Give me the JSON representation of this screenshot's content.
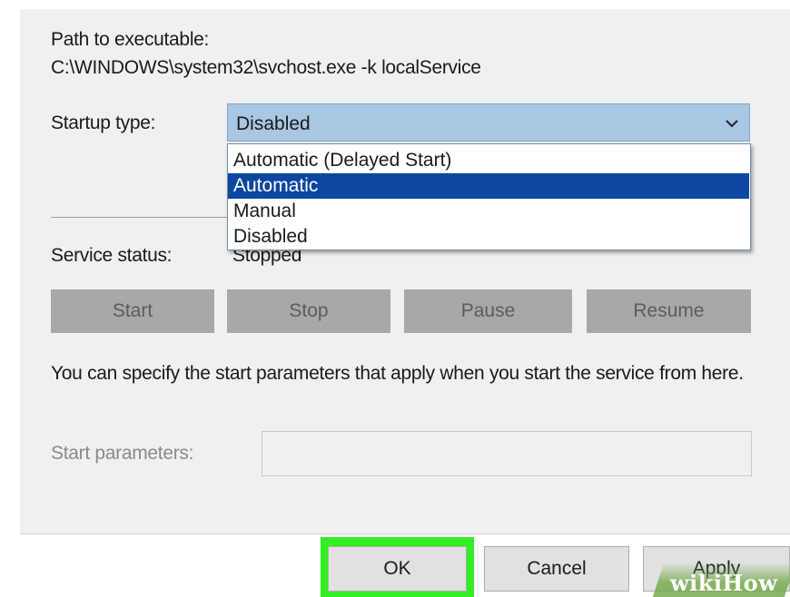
{
  "path": {
    "label": "Path to executable:",
    "value": "C:\\WINDOWS\\system32\\svchost.exe -k localService"
  },
  "startup": {
    "label": "Startup type:",
    "selected": "Disabled",
    "options": [
      "Automatic (Delayed Start)",
      "Automatic",
      "Manual",
      "Disabled"
    ],
    "highlighted_option": "Automatic",
    "arrow_icon": "chevron-down-icon"
  },
  "status": {
    "label": "Service status:",
    "value": "Stopped"
  },
  "service_buttons": {
    "start": "Start",
    "stop": "Stop",
    "pause": "Pause",
    "resume": "Resume"
  },
  "params": {
    "description": "You can specify the start parameters that apply when you start the service from here.",
    "label": "Start parameters:",
    "value": ""
  },
  "dialog_buttons": {
    "ok": "OK",
    "cancel": "Cancel",
    "apply": "Apply"
  },
  "watermark": "wikiHow",
  "colors": {
    "highlight_green": "#33ee22",
    "selected_blue": "#0d47a1",
    "combo_fill": "#a9c6e3"
  }
}
